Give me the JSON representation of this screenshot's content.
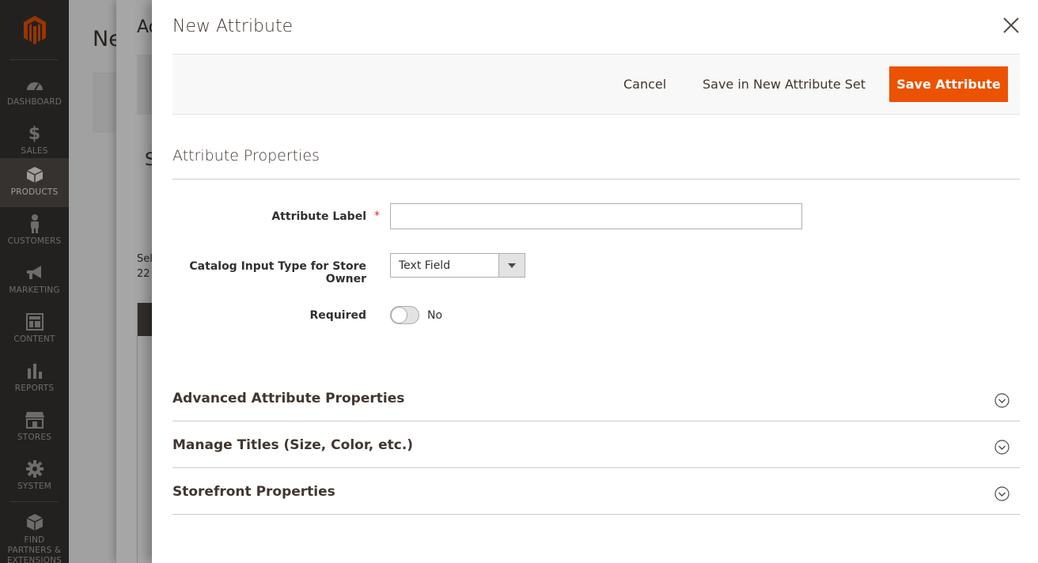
{
  "sidebar": {
    "logo": "magento-logo",
    "items": [
      {
        "label": "DASHBOARD",
        "icon": "dashboard-icon"
      },
      {
        "label": "SALES",
        "icon": "dollar-icon"
      },
      {
        "label": "PRODUCTS",
        "icon": "box-icon",
        "active": true
      },
      {
        "label": "CUSTOMERS",
        "icon": "person-icon"
      },
      {
        "label": "MARKETING",
        "icon": "megaphone-icon"
      },
      {
        "label": "CONTENT",
        "icon": "layout-icon"
      },
      {
        "label": "REPORTS",
        "icon": "bar-chart-icon"
      },
      {
        "label": "STORES",
        "icon": "store-icon"
      },
      {
        "label": "SYSTEM",
        "icon": "gear-icon"
      },
      {
        "label": "FIND PARTNERS & EXTENSIONS",
        "icon": "cubes-icon"
      }
    ]
  },
  "background": {
    "page_title_partial": "Ne",
    "slide_title_partial": "Ad",
    "slide_section_partial": "S",
    "slide_text1": "Sel",
    "slide_text2": "22"
  },
  "modal": {
    "title": "New Attribute",
    "actions": {
      "cancel": "Cancel",
      "save_new_set": "Save in New Attribute Set",
      "save": "Save Attribute"
    },
    "section_title": "Attribute Properties",
    "fields": {
      "attribute_label": {
        "label": "Attribute Label",
        "value": "",
        "required": true
      },
      "catalog_input_type": {
        "label": "Catalog Input Type for Store Owner",
        "value": "Text Field"
      },
      "required": {
        "label": "Required",
        "value": "No"
      }
    },
    "collapsibles": [
      "Advanced Attribute Properties",
      "Manage Titles (Size, Color, etc.)",
      "Storefront Properties"
    ]
  },
  "colors": {
    "sidebar_bg": "#373330",
    "accent": "#eb5202"
  }
}
